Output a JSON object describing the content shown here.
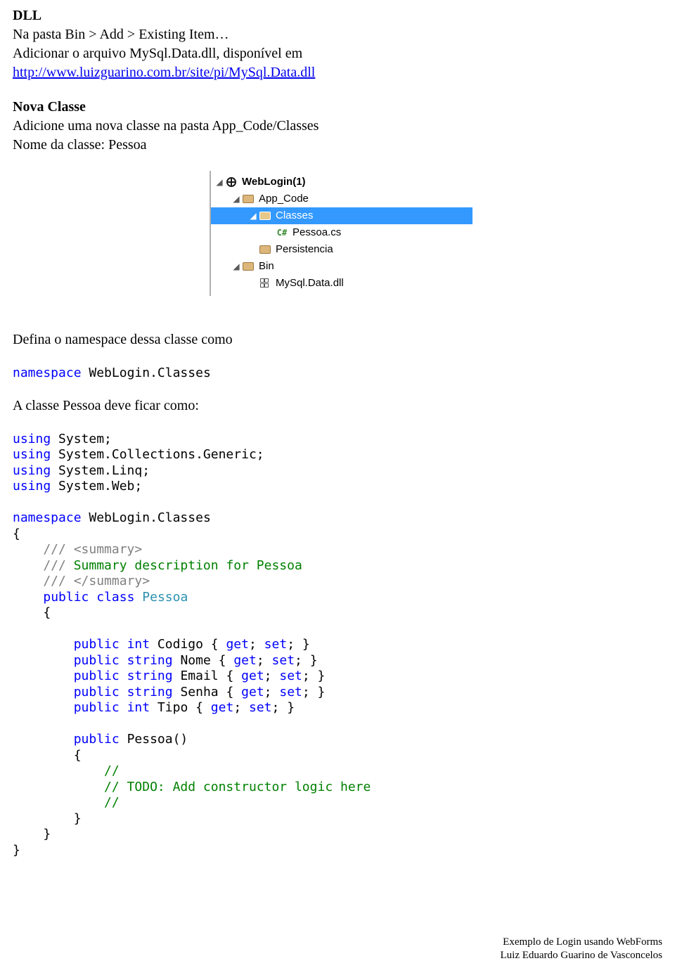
{
  "doc": {
    "h_dll": "DLL",
    "p_bin": "Na pasta Bin > Add > Existing Item…",
    "p_add1": "Adicionar o arquivo MySql.Data.dll, disponível em",
    "link_url": "http://www.luizguarino.com.br/site/pi/MySql.Data.dll",
    "h_nova": "Nova Classe",
    "p_nova1": "Adicione uma nova classe na pasta App_Code/Classes",
    "p_nova2": "Nome da classe: Pessoa",
    "p_def_ns": "Defina o namespace dessa classe como",
    "p_classe": "A classe Pessoa deve ficar como:"
  },
  "sln": {
    "root": "WebLogin(1)",
    "appcode": "App_Code",
    "classes": "Classes",
    "pessoa": "Pessoa.cs",
    "persist": "Persistencia",
    "bin": "Bin",
    "dll": "MySql.Data.dll"
  },
  "code1": {
    "kw_ns": "namespace",
    "ns_name": " WebLogin.Classes"
  },
  "code2": {
    "u1a": "using",
    "u1b": " System;",
    "u2a": "using",
    "u2b": " System.Collections.Generic;",
    "u3a": "using",
    "u3b": " System.Linq;",
    "u4a": "using",
    "u4b": " System.Web;",
    "ns_a": "namespace",
    "ns_b": " WebLogin.Classes",
    "ob": "{",
    "c1": "    /// <summary>",
    "c2a": "    /// ",
    "c2b": "Summary description for Pessoa",
    "c3": "    /// </summary>",
    "pub": "public",
    "cls": "class",
    "cls_name": "Pessoa",
    "ob2": "    {",
    "p1a": "public",
    "p1b": "int",
    "p1c": " Codigo { ",
    "get": "get",
    "set": "set",
    "p1d": "; ",
    "p1e": "; }",
    "str": "string",
    "nome": " Nome { ",
    "email": " Email { ",
    "senha": " Senha { ",
    "tipo": " Tipo { ",
    "ctor": " Pessoa()",
    "ob3": "        {",
    "cc1": "            //",
    "cc2": "            // TODO: Add constructor logic here",
    "cc3": "            //",
    "cb3": "        }",
    "cb2": "    }",
    "cb": "}"
  },
  "footer": {
    "l1": "Exemplo de Login usando WebForms",
    "l2": "Luiz Eduardo Guarino de Vasconcelos"
  }
}
